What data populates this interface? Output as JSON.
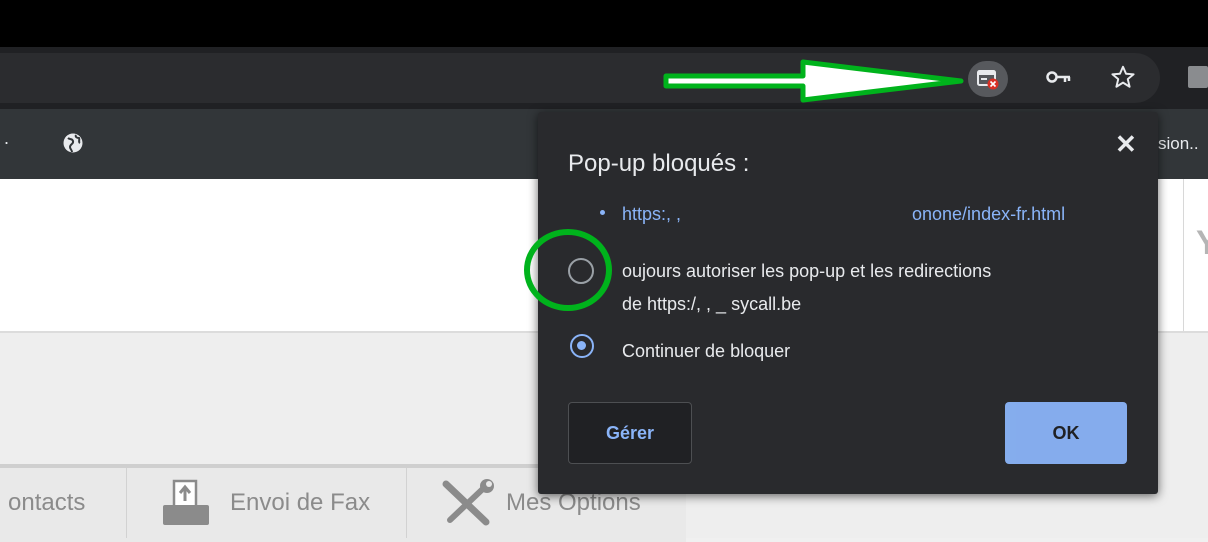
{
  "bookmarks": {
    "left_text": ".",
    "right_text": "sion.."
  },
  "popup": {
    "title": "Pop-up bloqués :",
    "blocked_url_start": "https:,  ,",
    "blocked_url_end": "onone/index-fr.html",
    "option_allow_line1": "oujours autoriser les pop-up et les redirections",
    "option_allow_line2": "de https:/,                  ,  _          sycall.be",
    "option_block": "Continuer de bloquer",
    "manage_label": "Gérer",
    "ok_label": "OK",
    "selected_option": "block"
  },
  "tabs": [
    {
      "label": "ontacts"
    },
    {
      "label": "Envoi de Fax"
    },
    {
      "label": "Mes Options"
    }
  ],
  "colors": {
    "annotation": "#00b31c",
    "accent": "#8ab4f8"
  }
}
